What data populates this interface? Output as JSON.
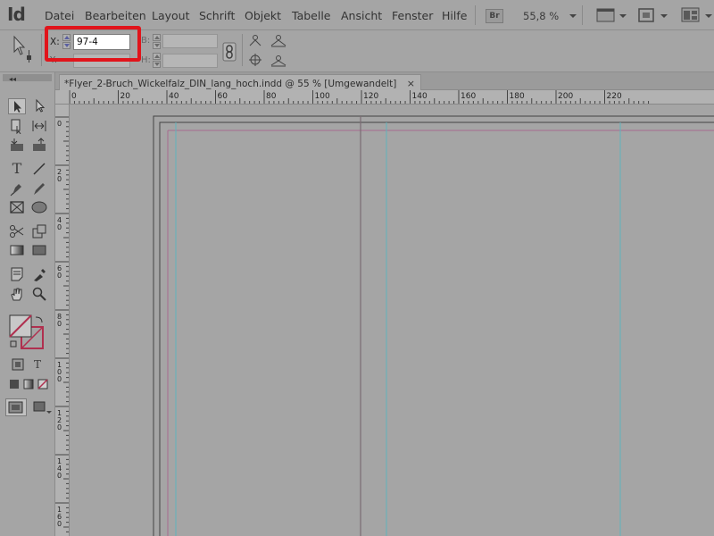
{
  "app": {
    "logo": "Id"
  },
  "menu": {
    "items": [
      "Datei",
      "Bearbeiten",
      "Layout",
      "Schrift",
      "Objekt",
      "Tabelle",
      "Ansicht",
      "Fenster",
      "Hilfe"
    ],
    "bridge_badge": "Br",
    "zoom": "55,8 %"
  },
  "control": {
    "x_label": "X:",
    "x_value": "97-4",
    "y_label": "Y:",
    "w_label": "B:",
    "h_label": "H:"
  },
  "document": {
    "tab_title": "*Flyer_2-Bruch_Wickelfalz_DIN_lang_hoch.indd @ 55 % [Umgewandelt]",
    "close_glyph": "×"
  },
  "ruler": {
    "h_labels": [
      "0",
      "20",
      "40",
      "60",
      "80",
      "100",
      "120",
      "140",
      "160",
      "180",
      "200",
      "220"
    ],
    "v_labels": [
      "0",
      "20",
      "40",
      "60",
      "80",
      "100",
      "120",
      "140",
      "160"
    ]
  },
  "colors": {
    "highlight": "#e1141b",
    "guide_cyan": "#5fb4bd",
    "margin_magenta": "#a86a8e",
    "fold_dark": "#7a6b73"
  },
  "tools": {
    "type_label": "T",
    "text_mode_label": "T"
  }
}
